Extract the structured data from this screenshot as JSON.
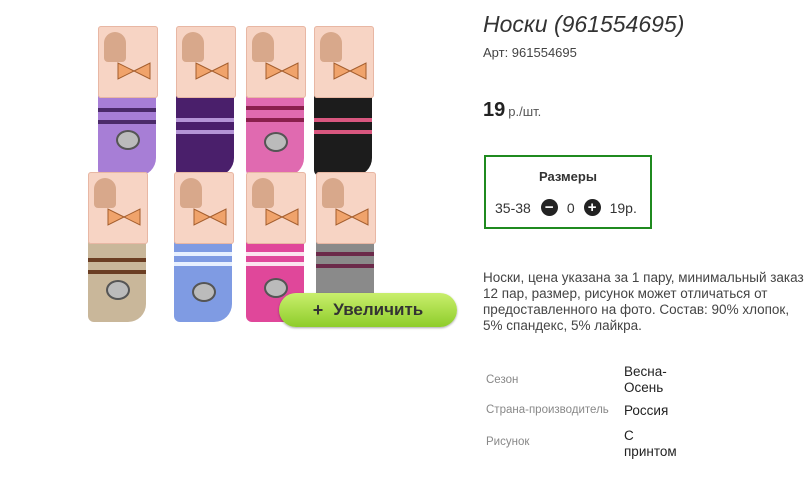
{
  "product": {
    "title": "Носки (961554695)",
    "article": "Арт: 961554695",
    "price_value": "19",
    "price_unit": "р./шт."
  },
  "sizes": {
    "header": "Размеры",
    "range": "35-38",
    "quantity": "0",
    "price": "19р."
  },
  "zoom_button": {
    "plus": "+",
    "label": "Увеличить"
  },
  "description": "Носки, цена указана за 1 пару, минимальный заказ 12 пар, размер, рисунок может отличаться от предоставленного на фото. Состав: 90% хлопок, 5% спандекс, 5% лайкра.",
  "properties": [
    {
      "key": "Сезон",
      "value": "Весна-Осень"
    },
    {
      "key": "Страна-производитель",
      "value": "Россия"
    },
    {
      "key": "Рисунок",
      "value": "С принтом"
    }
  ],
  "colors": {
    "accent_border": "#1f8a1f",
    "zoom_button": "#a6dd3f",
    "sock_colors": [
      "#a77ed6",
      "#4a1f6b",
      "#e06ab0",
      "#1c1c1c",
      "#c9b79a",
      "#7f9be3",
      "#e0479a",
      "#8a8a8a"
    ]
  }
}
